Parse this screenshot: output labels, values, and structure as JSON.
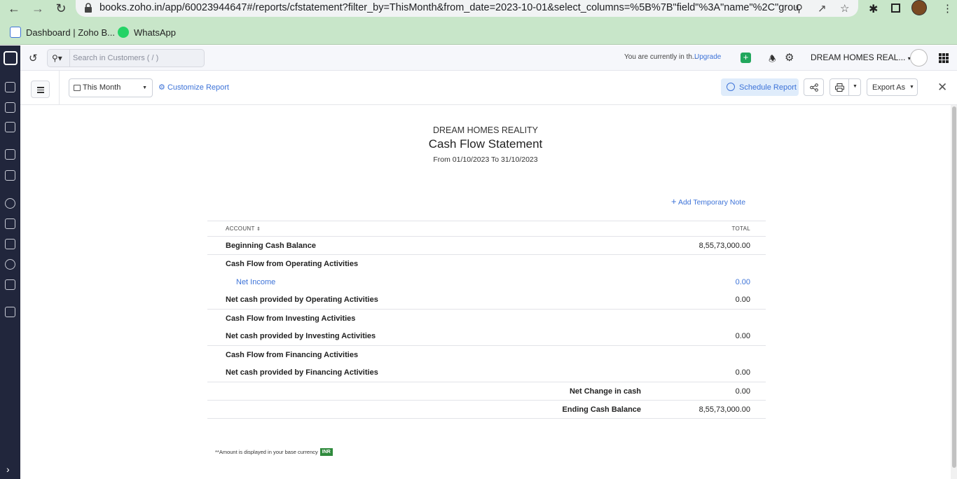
{
  "browser": {
    "url": "books.zoho.in/app/60023944647#/reports/cfstatement?filter_by=ThisMonth&from_date=2023-10-01&select_columns=%5B%7B\"field\"%3A\"name\"%2C\"grou...",
    "bookmarks": [
      {
        "label": "Dashboard | Zoho B...",
        "icon": "zoho-books-icon"
      },
      {
        "label": "WhatsApp",
        "icon": "whatsapp-icon"
      }
    ]
  },
  "header": {
    "search_placeholder": "Search in Customers ( / )",
    "trial_text": "You are currently in th...",
    "upgrade_label": "Upgrade",
    "org_name": "DREAM HOMES REAL..."
  },
  "toolbar": {
    "period": "This Month",
    "customize_label": "Customize Report",
    "schedule_label": "Schedule Report",
    "export_label": "Export As"
  },
  "report": {
    "company": "DREAM HOMES REALITY",
    "title": "Cash Flow Statement",
    "date_range": "From 01/10/2023 To 31/10/2023",
    "add_note_label": "Add Temporary Note",
    "columns": {
      "account": "ACCOUNT",
      "total": "TOTAL"
    },
    "rows": {
      "beginning": {
        "label": "Beginning Cash Balance",
        "value": "8,55,73,000.00"
      },
      "operating_header": "Cash Flow from Operating Activities",
      "net_income": {
        "label": "Net Income",
        "value": "0.00"
      },
      "operating_net": {
        "label": "Net cash provided by Operating Activities",
        "value": "0.00"
      },
      "investing_header": "Cash Flow from Investing Activities",
      "investing_net": {
        "label": "Net cash provided by Investing Activities",
        "value": "0.00"
      },
      "financing_header": "Cash Flow from Financing Activities",
      "financing_net": {
        "label": "Net cash provided by Financing Activities",
        "value": "0.00"
      },
      "net_change": {
        "label": "Net Change in cash",
        "value": "0.00"
      },
      "ending": {
        "label": "Ending Cash Balance",
        "value": "8,55,73,000.00"
      }
    },
    "footnote": "**Amount is displayed in your base currency",
    "currency": "INR"
  },
  "colors": {
    "accent": "#3d73d8",
    "sidebar": "#21263c",
    "browser_frame": "#c8e6c9",
    "success": "#22a75d"
  }
}
